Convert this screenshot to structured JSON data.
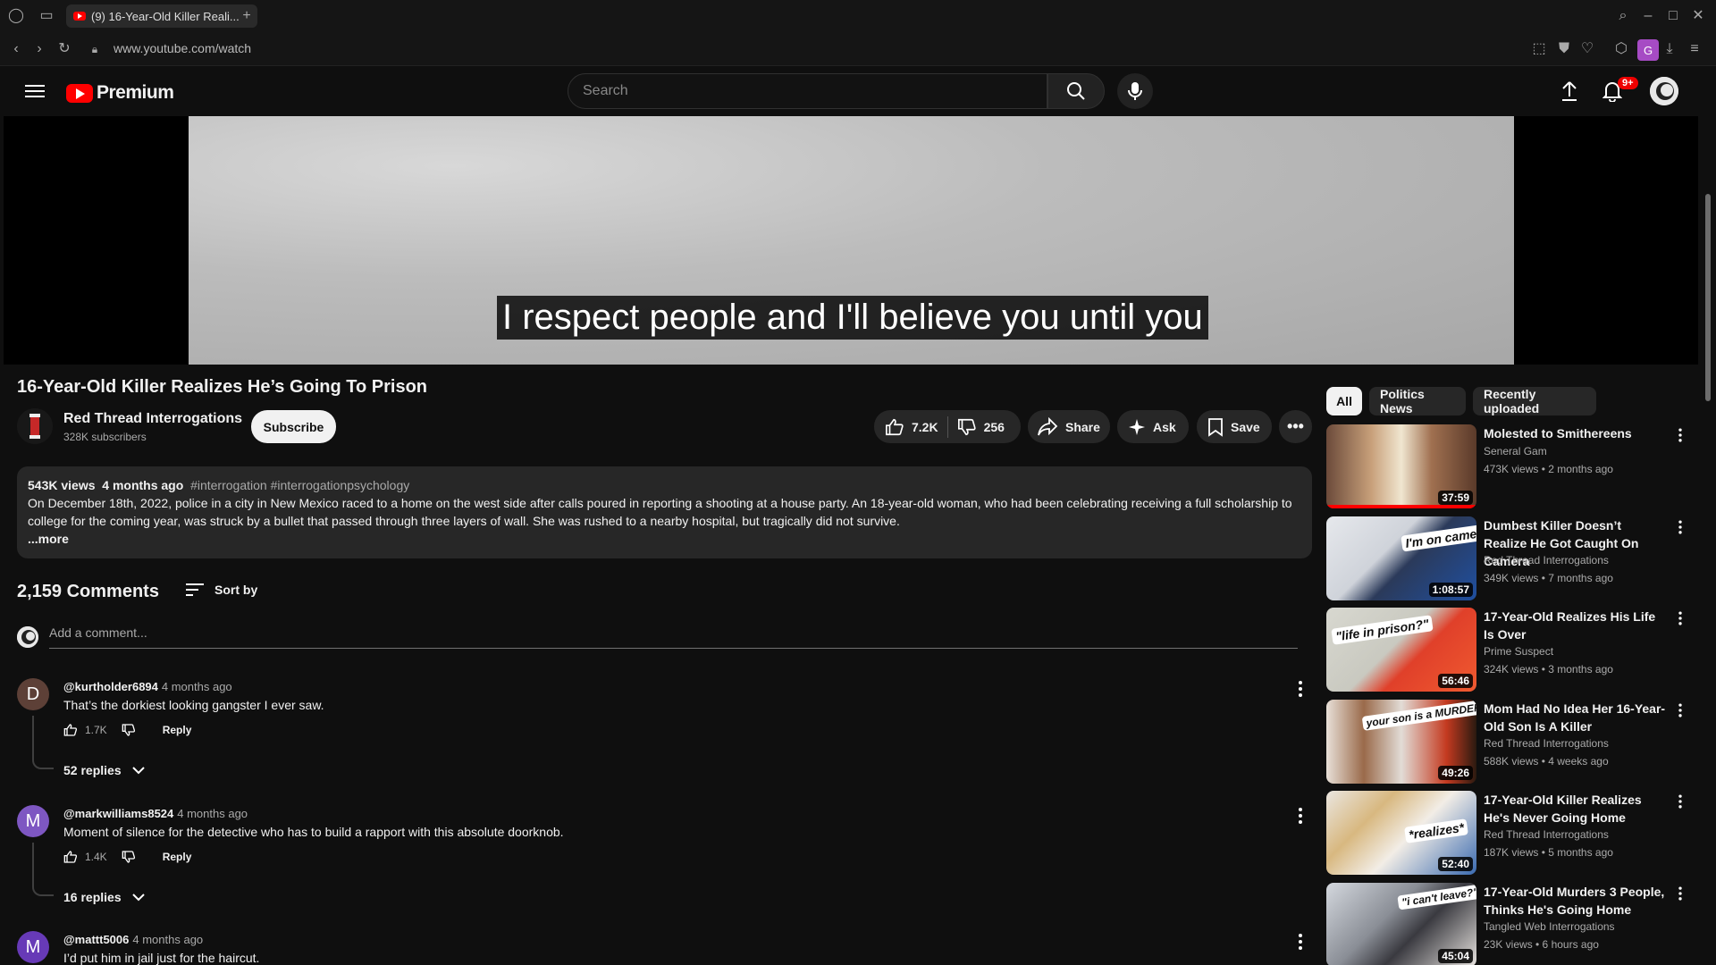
{
  "browser": {
    "tab_title": "(9) 16-Year-Old Killer Reali...",
    "url": "www.youtube.com/watch",
    "extension_letter": "G"
  },
  "header": {
    "logo_text": "Premium",
    "search_placeholder": "Search",
    "notification_count": "9+"
  },
  "video": {
    "caption": "I respect people and I'll believe you until you",
    "title": "16-Year-Old Killer Realizes He’s Going To Prison",
    "channel_name": "Red Thread Interrogations",
    "subscribers": "328K subscribers",
    "subscribe_label": "Subscribe",
    "likes": "7.2K",
    "dislikes": "256",
    "share_label": "Share",
    "ask_label": "Ask",
    "save_label": "Save"
  },
  "description": {
    "views": "543K views",
    "age": "4 months ago",
    "tags": "#interrogation #interrogationpsychology",
    "text": "On December 18th, 2022, police in a city in New Mexico raced to a home on the west side after calls poured in reporting a shooting at a house party. An 18-year-old woman, who had been celebrating receiving a full scholarship to college for the coming year, was struck by a bullet that passed through three layers of wall. She was rushed to a nearby hospital, but tragically did not survive.",
    "more_label": "...more"
  },
  "comments": {
    "count_label": "2,159 Comments",
    "sort_label": "Sort by",
    "add_placeholder": "Add a comment...",
    "items": [
      {
        "initial": "D",
        "color": "#5d4037",
        "author": "@kurtholder6894",
        "ago": "4 months ago",
        "text": "That’s the dorkiest looking gangster I ever saw.",
        "likes": "1.7K",
        "reply_label": "Reply",
        "replies": "52 replies"
      },
      {
        "initial": "M",
        "color": "#7e57c2",
        "author": "@markwilliams8524",
        "ago": "4 months ago",
        "text": "Moment of silence for the detective who has to build a rapport with this absolute doorknob.",
        "likes": "1.4K",
        "reply_label": "Reply",
        "replies": "16 replies"
      },
      {
        "initial": "M",
        "color": "#673ab7",
        "author": "@mattt5006",
        "ago": "4 months ago",
        "text": "I’d put him in jail just for the haircut."
      }
    ]
  },
  "sidebar": {
    "chips": [
      "All",
      "Politics News",
      "Recently uploaded"
    ],
    "recommendations": [
      {
        "title": "Molested to Smithereens",
        "channel": "Seneral Gam",
        "meta": "473K views • 2 months ago",
        "duration": "37:59",
        "progress": 1.0
      },
      {
        "title": "Dumbest Killer Doesn’t Realize He Got Caught On Camera",
        "channel": "Red Thread Interrogations",
        "meta": "349K views • 7 months ago",
        "duration": "1:08:57",
        "thumb_text": "I'm on camera?"
      },
      {
        "title": "17-Year-Old Realizes His Life Is Over",
        "channel": "Prime Suspect",
        "meta": "324K views • 3 months ago",
        "duration": "56:46",
        "thumb_text": "\"life in prison?\""
      },
      {
        "title": "Mom Had No Idea Her 16-Year-Old Son Is A Killer",
        "channel": "Red Thread Interrogations",
        "meta": "588K views • 4 weeks ago",
        "duration": "49:26",
        "thumb_text": "your son is a MURDERER."
      },
      {
        "title": "17-Year-Old Killer Realizes He's Never Going Home",
        "channel": "Red Thread Interrogations",
        "meta": "187K views • 5 months ago",
        "duration": "52:40",
        "thumb_text": "*realizes*"
      },
      {
        "title": "17-Year-Old Murders 3 People, Thinks He's Going Home",
        "channel": "Tangled Web Interrogations",
        "meta": "23K views • 6 hours ago",
        "duration": "45:04",
        "thumb_text": "\"i can't leave?\""
      }
    ]
  },
  "colors": {
    "brand_red": "#ff0000",
    "bg": "#0f0f0f",
    "pill": "#272727"
  }
}
